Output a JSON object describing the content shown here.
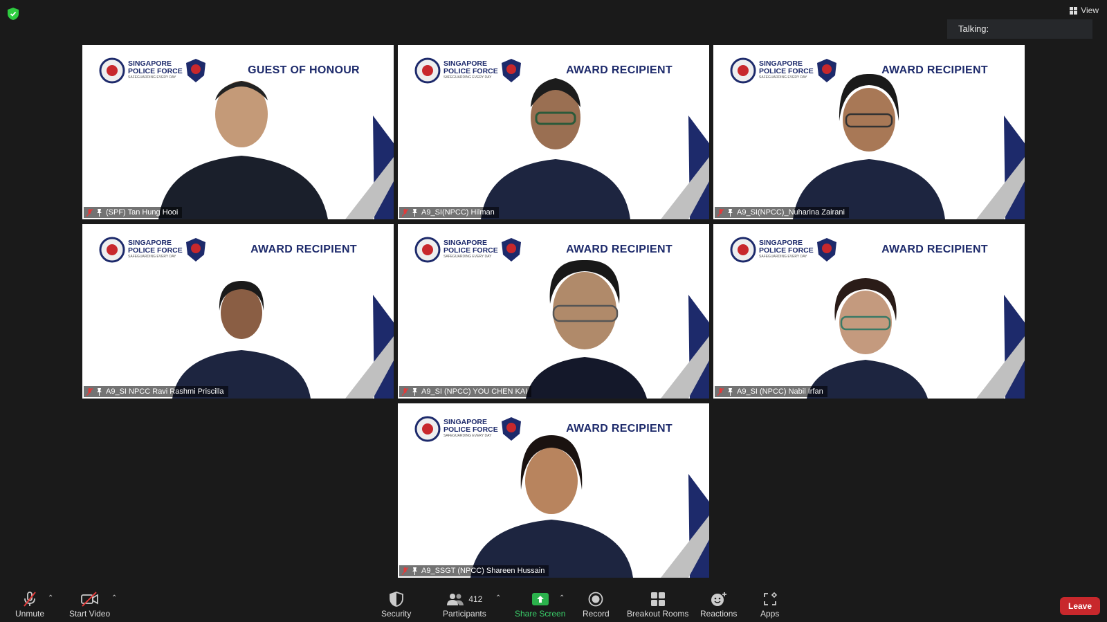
{
  "top": {
    "view_label": "View",
    "talking_label": "Talking:"
  },
  "org": {
    "brand_line1": "SINGAPORE",
    "brand_line2": "POLICE FORCE",
    "brand_tagline": "SAFEGUARDING EVERY DAY"
  },
  "tiles": [
    {
      "banner": "GUEST OF HONOUR",
      "name": "(SPF) Tan Hung Hooi"
    },
    {
      "banner": "AWARD RECIPIENT",
      "name": "A9_SI(NPCC) Hilman"
    },
    {
      "banner": "AWARD RECIPIENT",
      "name": "A9_SI(NPCC)_Nuharina Zairani"
    },
    {
      "banner": "AWARD RECIPIENT",
      "name": "A9_SI NPCC Ravi Rashmi Priscilla"
    },
    {
      "banner": "AWARD RECIPIENT",
      "name": "A9_SI (NPCC) YOU CHEN KAI"
    },
    {
      "banner": "AWARD RECIPIENT",
      "name": "A9_SI (NPCC) Nabil Irfan"
    },
    {
      "banner": "AWARD RECIPIENT",
      "name": "A9_SSGT (NPCC) Shareen Hussain"
    }
  ],
  "toolbar": {
    "unmute": "Unmute",
    "start_video": "Start Video",
    "security": "Security",
    "participants": "Participants",
    "participants_count": "412",
    "share_screen": "Share Screen",
    "record": "Record",
    "breakout_rooms": "Breakout Rooms",
    "reactions": "Reactions",
    "apps": "Apps",
    "leave": "Leave"
  },
  "colors": {
    "background": "#1a1a1a",
    "brand_navy": "#1d2a6b",
    "leave_red": "#c8282c",
    "share_green": "#2bb24c",
    "security_shield": "#2ecc40"
  }
}
